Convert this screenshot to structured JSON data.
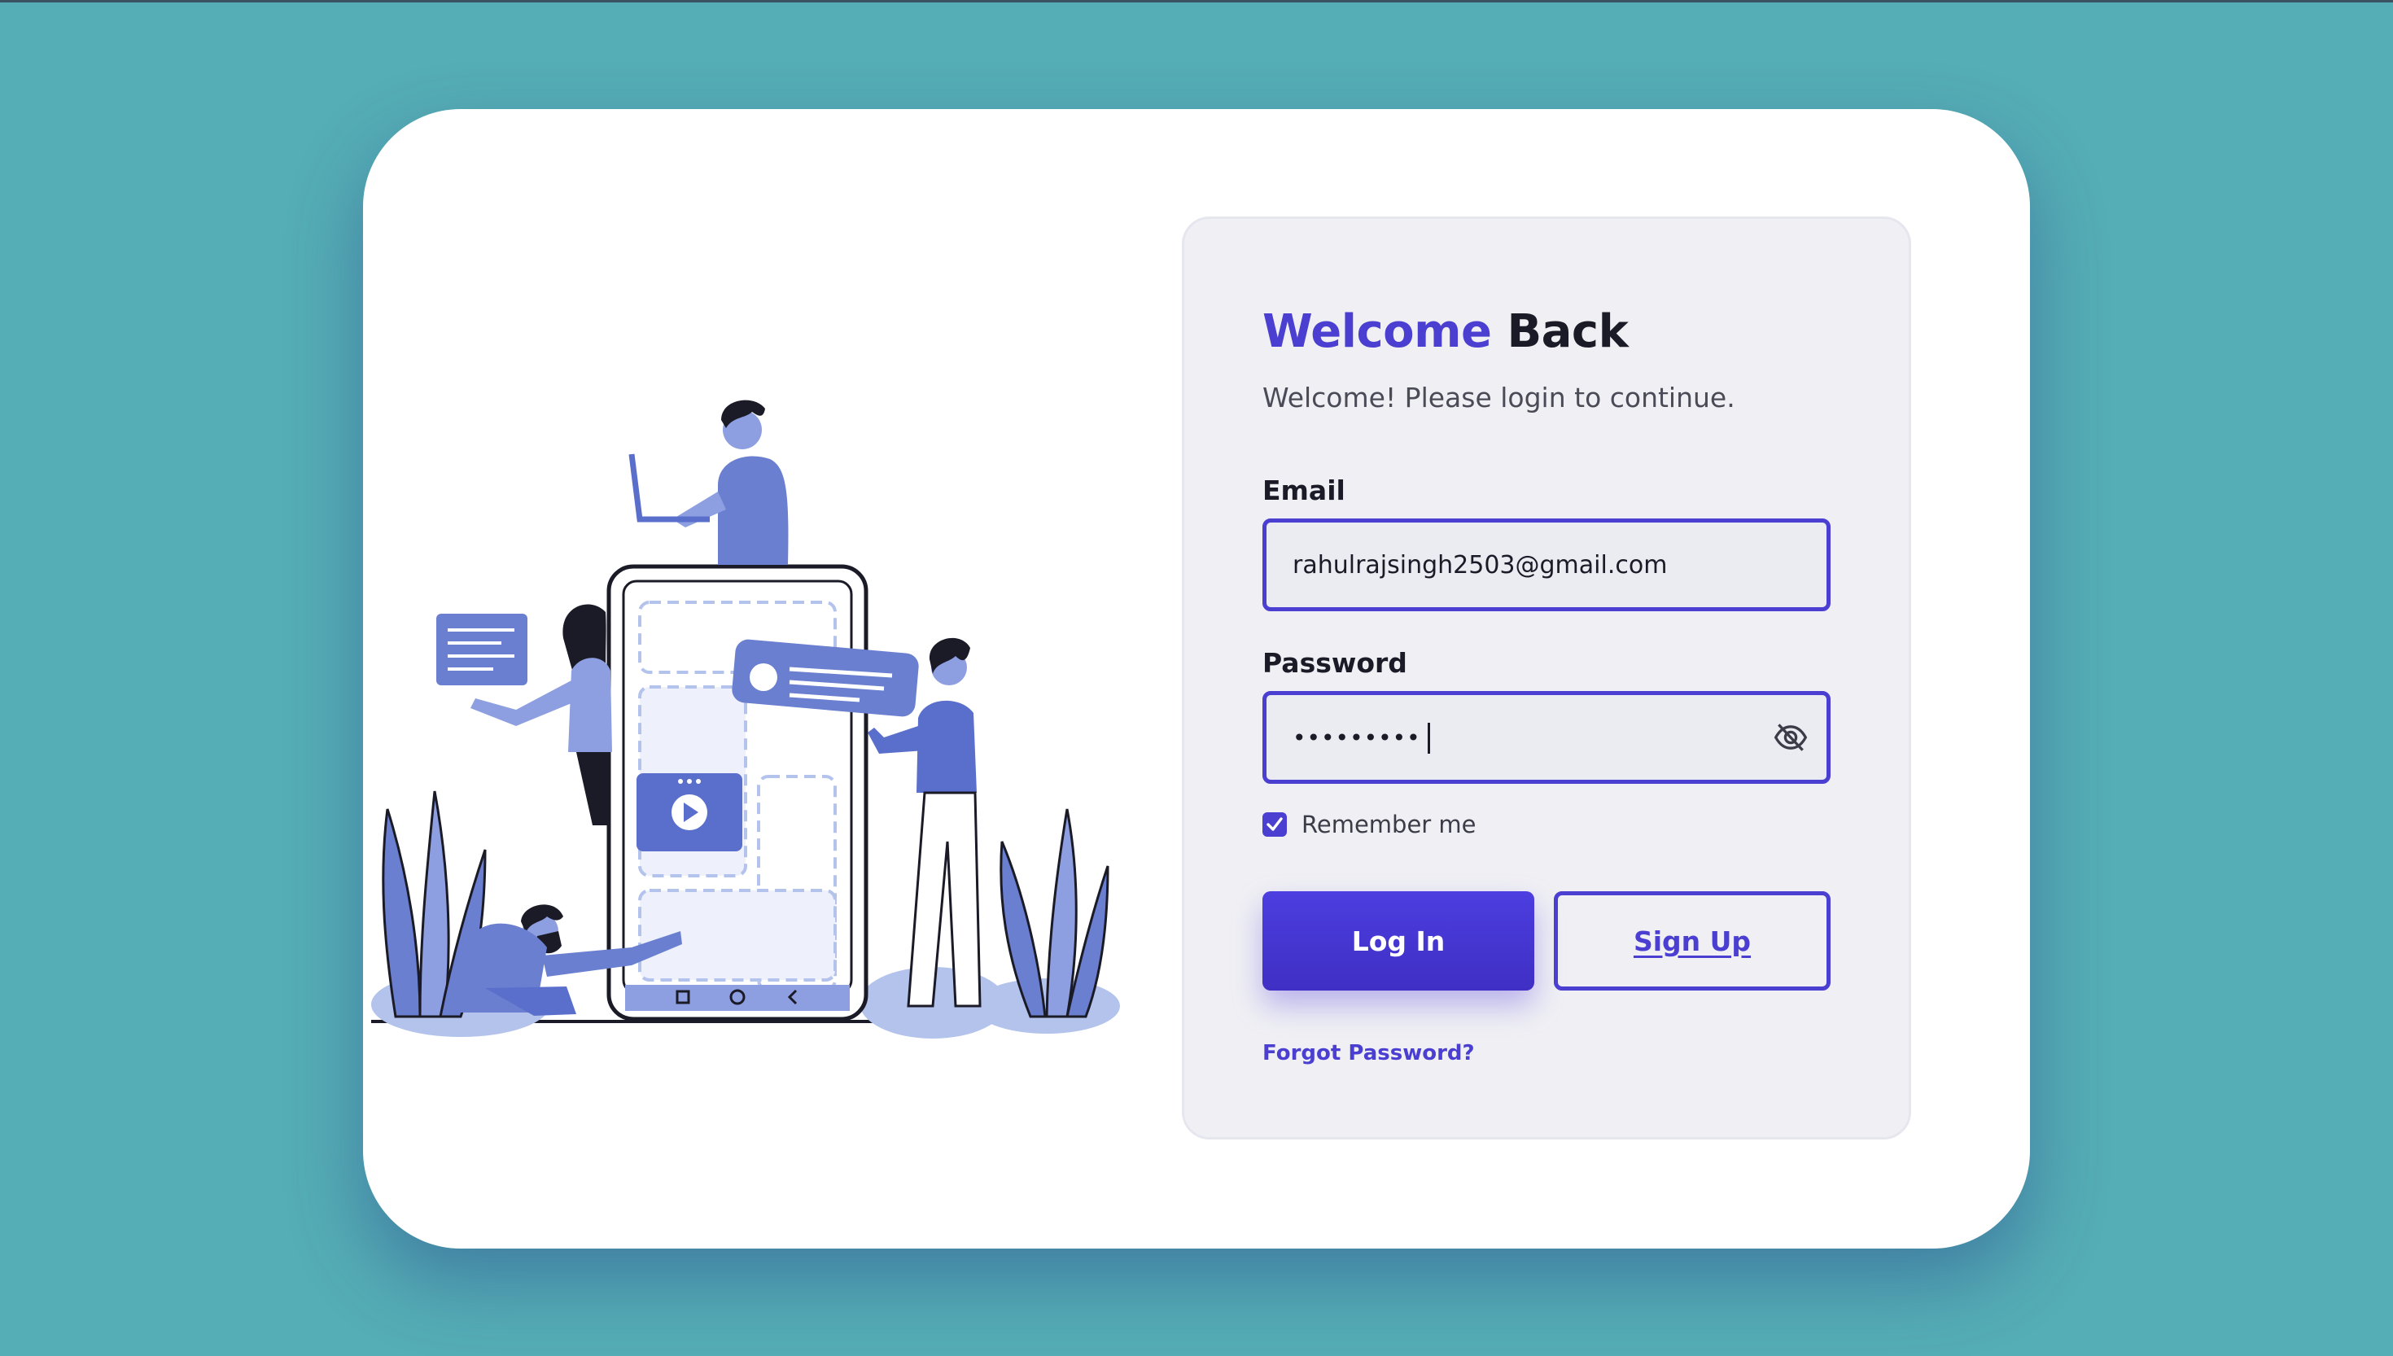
{
  "login": {
    "title_accent": "Welcome",
    "title_rest": "Back",
    "subtitle": "Welcome! Please login to continue.",
    "email_label": "Email",
    "email_value": "rahulrajsingh2503@gmail.com",
    "password_label": "Password",
    "password_value": "•••••••••••••",
    "password_toggle_icon": "eye-slash-icon",
    "remember_label": "Remember me",
    "remember_checked": true,
    "login_button": "Log In",
    "signup_button": "Sign Up",
    "forgot_link": "Forgot Password?"
  },
  "colors": {
    "background": "#55adb5",
    "card": "#ffffff",
    "panel": "#f0f0f4",
    "accent": "#4a3fd0",
    "illustration": "#6a7fd0",
    "illustration_light": "#b3c3ec"
  },
  "illustration": {
    "icon": "mobile-app-team-illustration"
  }
}
